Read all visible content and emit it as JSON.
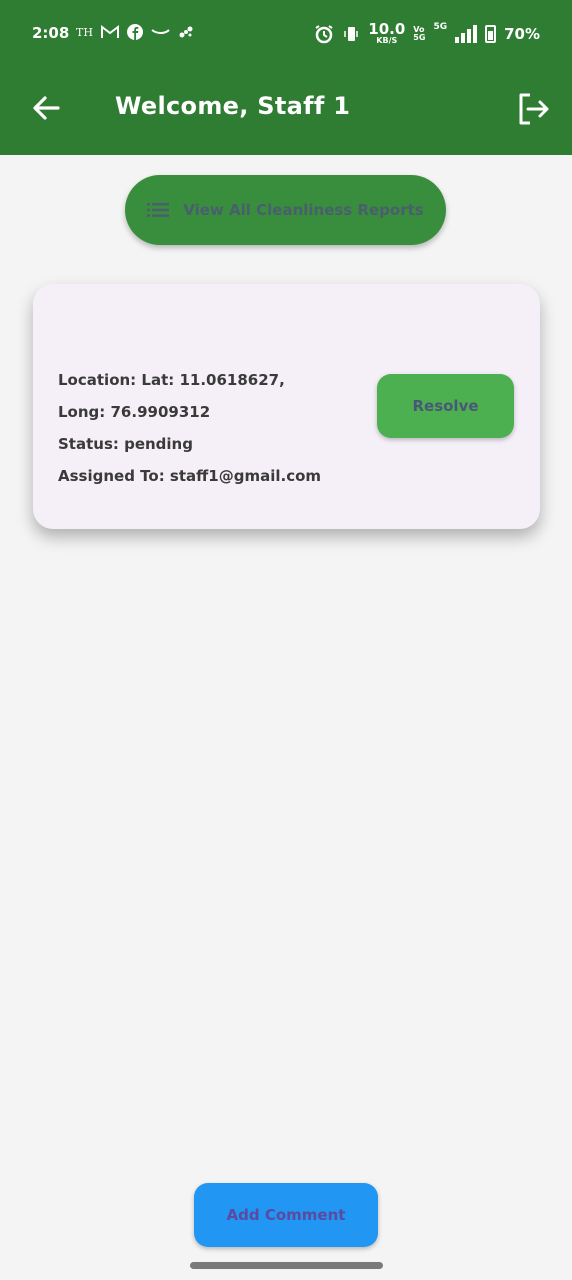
{
  "status_bar": {
    "time": "2:08",
    "left_icons": [
      "th-icon",
      "gmail-icon",
      "facebook-icon",
      "amazon-icon",
      "fan-icon"
    ],
    "th_label": "TH",
    "net_speed_value": "10.0",
    "net_speed_unit": "KB/S",
    "vo_top": "Vo",
    "vo_bottom": "5G",
    "network": "5G",
    "battery_pct": "70%"
  },
  "app_bar": {
    "title": "Welcome, Staff 1",
    "color": "#2e7d32"
  },
  "view_reports_button": {
    "label": "View All Cleanliness Reports",
    "icon": "list-icon",
    "color": "#388e3c"
  },
  "report_card": {
    "location_line": "Location: Lat: 11.0618627, Long: 76.9909312",
    "status_line": "Status: pending",
    "assigned_line": "Assigned To: staff1@gmail.com",
    "resolve_label": "Resolve",
    "resolve_color": "#4caf50"
  },
  "add_comment_button": {
    "label": "Add Comment",
    "color": "#2196f3"
  }
}
